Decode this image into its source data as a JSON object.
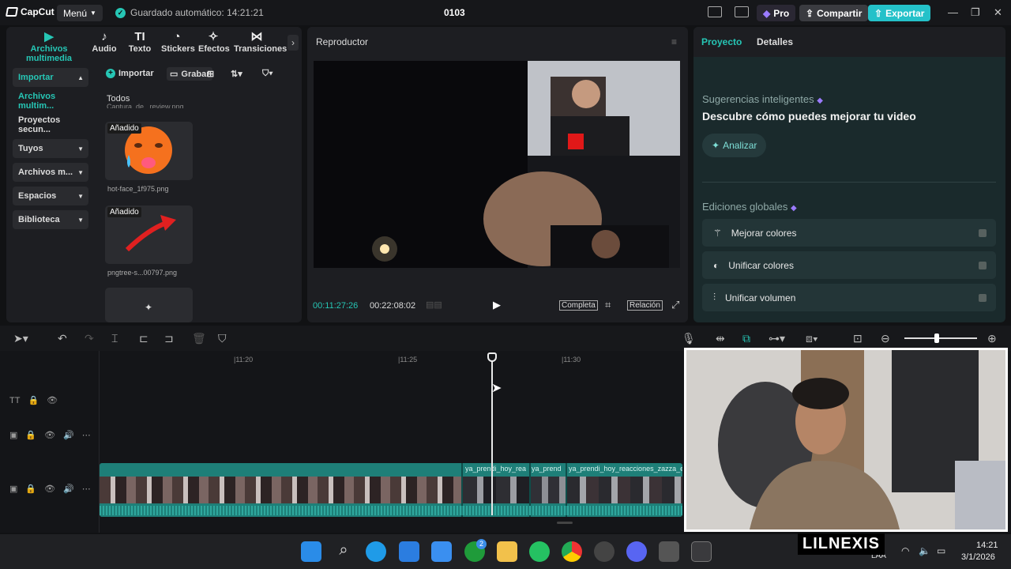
{
  "titlebar": {
    "app_name": "CapCut",
    "menu_label": "Menú",
    "autosave_text": "Guardado automático: 14:21:21",
    "project_title": "0103",
    "pro_label": "Pro",
    "share_label": "Compartir",
    "export_label": "Exportar"
  },
  "media": {
    "tabs": [
      {
        "label": "Archivos multimedia",
        "icon": "media-icon"
      },
      {
        "label": "Audio",
        "icon": "audio-icon"
      },
      {
        "label": "Texto",
        "icon": "text-icon"
      },
      {
        "label": "Stickers",
        "icon": "sticker-icon"
      },
      {
        "label": "Efectos",
        "icon": "effects-icon"
      },
      {
        "label": "Transiciones",
        "icon": "transitions-icon"
      }
    ],
    "sidebar": [
      {
        "label": "Importar"
      },
      {
        "label": "Archivos multim..."
      },
      {
        "label": "Proyectos secun..."
      },
      {
        "label": "Tuyos"
      },
      {
        "label": "Archivos m..."
      },
      {
        "label": "Espacios"
      },
      {
        "label": "Biblioteca"
      }
    ],
    "import_label": "Importar",
    "record_label": "Grabar",
    "filter_label": "Todos",
    "partial_caption": "Captura_de...review.png",
    "items": [
      {
        "badge": "Añadido",
        "caption": "hot-face_1f975.png"
      },
      {
        "badge": "Añadido",
        "caption": "pngtree-s...00797.png"
      }
    ]
  },
  "player": {
    "title": "Reproductor",
    "current_time": "00:11:27:26",
    "total_time": "00:22:08:02",
    "full_label": "Completa",
    "ratio_label": "Relación"
  },
  "right": {
    "tab_project": "Proyecto",
    "tab_details": "Detalles",
    "suggest_title": "Sugerencias inteligentes",
    "suggest_heading": "Descubre cómo puedes mejorar tu video",
    "analyze_label": "Analizar",
    "global_title": "Ediciones globales",
    "global_items": [
      {
        "label": "Mejorar colores"
      },
      {
        "label": "Unificar colores"
      },
      {
        "label": "Unificar volumen"
      }
    ]
  },
  "timeline": {
    "ruler": [
      "|11:20",
      "|11:25",
      "|11:30"
    ],
    "clip_names": [
      "ya_prendi_hoy_rea",
      "ya_prend",
      "ya_prendi_hoy_reacciones_zazza_e"
    ]
  },
  "taskbar": {
    "time": "14:21",
    "date": "3/1/2026",
    "lang": "LAA",
    "badge_count": "2"
  },
  "watermark": "LILNEXIS",
  "colors": {
    "accent": "#26c6b5",
    "export": "#24c1c9",
    "pro": "#9b7bff"
  }
}
